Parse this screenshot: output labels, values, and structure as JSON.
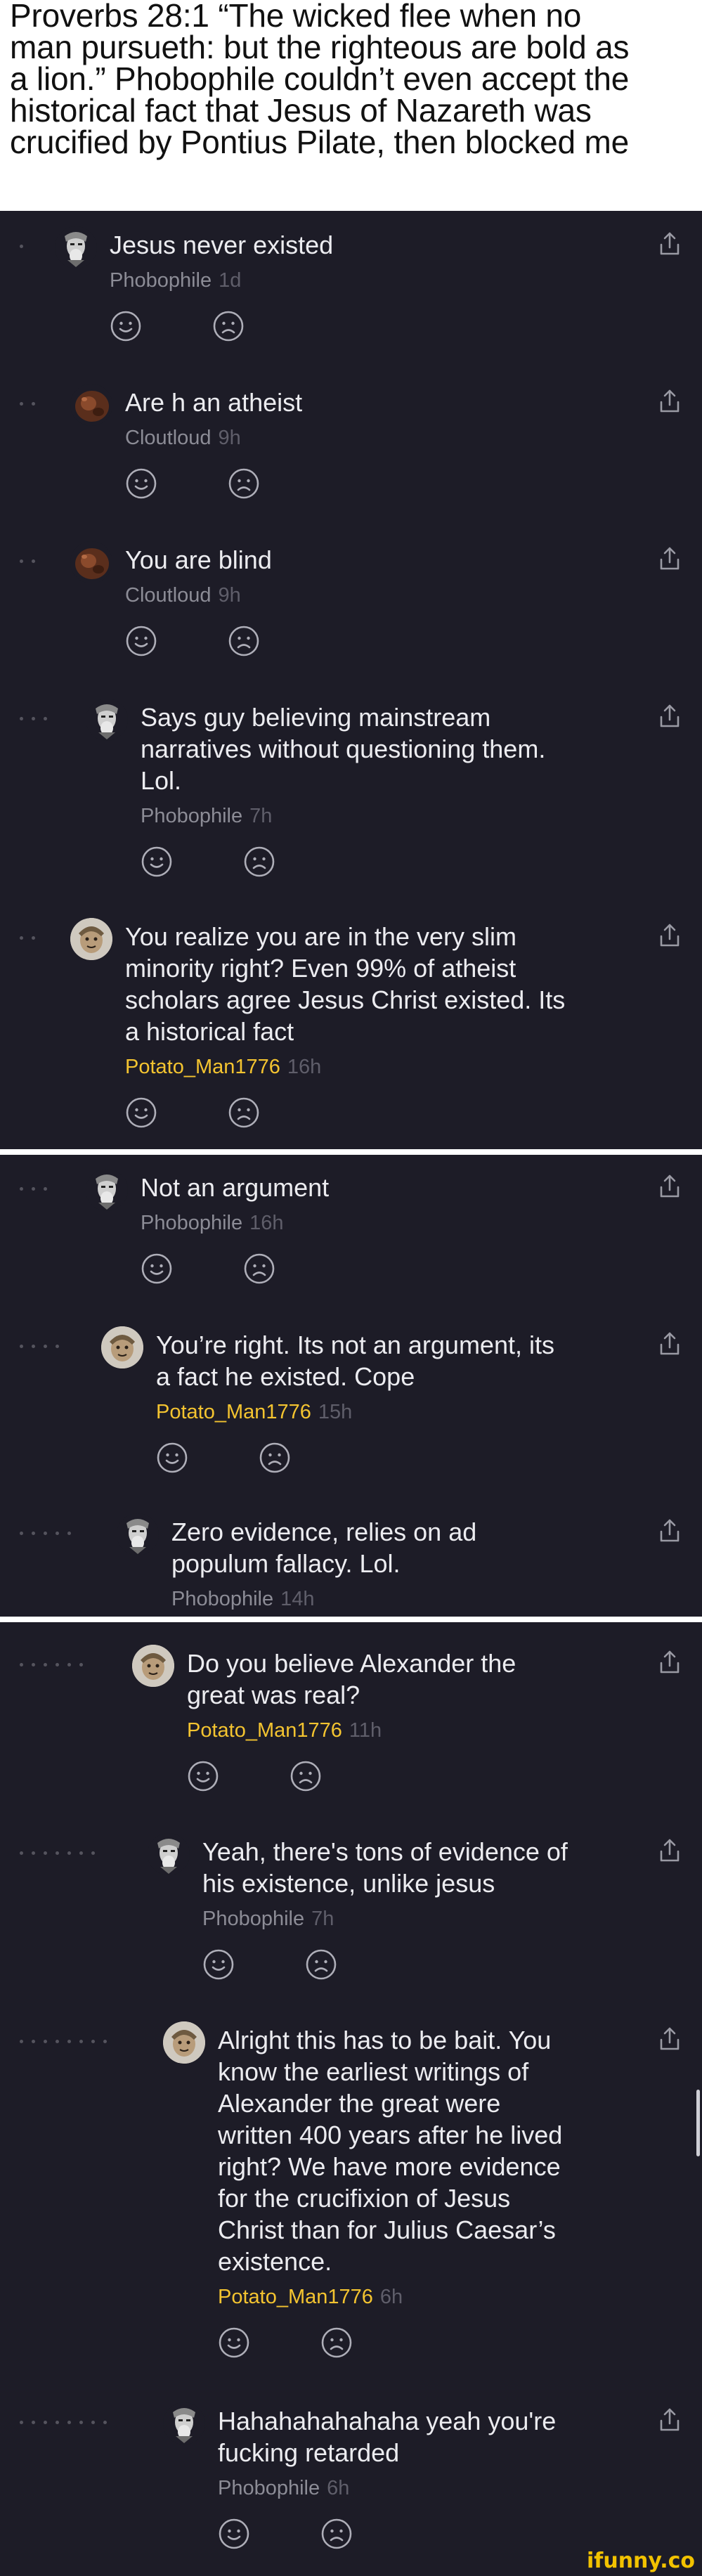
{
  "caption": {
    "lines": [
      "Proverbs 28:1 “The wicked flee when no",
      "man pursueth: but the righteous are bold as",
      "a lion.” Phobophile couldn’t even accept the",
      "historical fact that Jesus of Nazareth was",
      "crucified by Pontius Pilate, then blocked me"
    ]
  },
  "comments": [
    {
      "depth": 1,
      "avatar": "statue",
      "lines": [
        "Jesus never existed"
      ],
      "user": "Phobophile",
      "user_color": "gray",
      "time": "1d"
    },
    {
      "depth": 2,
      "avatar": "brown",
      "lines": [
        "Are h an atheist"
      ],
      "user": "Cloutloud",
      "user_color": "gray",
      "time": "9h"
    },
    {
      "depth": 2,
      "avatar": "brown",
      "lines": [
        "You are blind"
      ],
      "user": "Cloutloud",
      "user_color": "gray",
      "time": "9h"
    },
    {
      "depth": 3,
      "avatar": "statue",
      "lines": [
        "Says guy believing mainstream",
        "narratives without questioning them.",
        "Lol."
      ],
      "user": "Phobophile",
      "user_color": "gray",
      "time": "7h"
    },
    {
      "depth": 2,
      "avatar": "potato",
      "lines": [
        "You realize you are in the very slim",
        "minority right? Even 99% of atheist",
        "scholars agree Jesus Christ existed. Its",
        "a historical fact"
      ],
      "user": "Potato_Man1776",
      "user_color": "gold",
      "time": "16h"
    },
    {
      "depth": 3,
      "avatar": "statue",
      "lines": [
        "Not an argument"
      ],
      "user": "Phobophile",
      "user_color": "gray",
      "time": "16h"
    },
    {
      "depth": 4,
      "avatar": "potato",
      "lines": [
        "You’re right. Its not an argument, its",
        "a fact he existed. Cope"
      ],
      "user": "Potato_Man1776",
      "user_color": "gold",
      "time": "15h"
    },
    {
      "depth": 5,
      "avatar": "statue",
      "lines": [
        "Zero evidence, relies on ad",
        "populum fallacy. Lol."
      ],
      "user": "Phobophile",
      "user_color": "gray",
      "time": "14h"
    },
    {
      "depth": 6,
      "avatar": "potato",
      "lines": [
        "Do you believe Alexander the",
        "great was real?"
      ],
      "user": "Potato_Man1776",
      "user_color": "gold",
      "time": "11h"
    },
    {
      "depth": 7,
      "avatar": "statue",
      "lines": [
        "Yeah, there's tons of evidence of",
        "his existence, unlike jesus"
      ],
      "user": "Phobophile",
      "user_color": "gray",
      "time": "7h"
    },
    {
      "depth": 8,
      "avatar": "potato",
      "lines": [
        "Alright this has to be bait. You",
        "know the earliest writings of",
        "Alexander the great were",
        "written 400 years after he lived",
        "right? We have more evidence",
        "for the crucifixion of Jesus",
        "Christ than for Julius Caesar’s",
        "existence."
      ],
      "user": "Potato_Man1776",
      "user_color": "gold",
      "time": "6h"
    },
    {
      "depth": 8,
      "avatar": "statue",
      "lines": [
        "Hahahahahahaha yeah you're",
        "fucking retarded"
      ],
      "user": "Phobophile",
      "user_color": "gray",
      "time": "6h"
    }
  ],
  "icons": {
    "reactions": [
      "smile-icon",
      "frown-icon"
    ],
    "share": "share-icon"
  },
  "colors": {
    "background": "#1d1c27",
    "text": "#ececf0",
    "username_gray": "#8c8c96",
    "username_gold": "#f4c430",
    "timestamp": "#5f5e6a"
  },
  "watermark": "ifunny.co"
}
